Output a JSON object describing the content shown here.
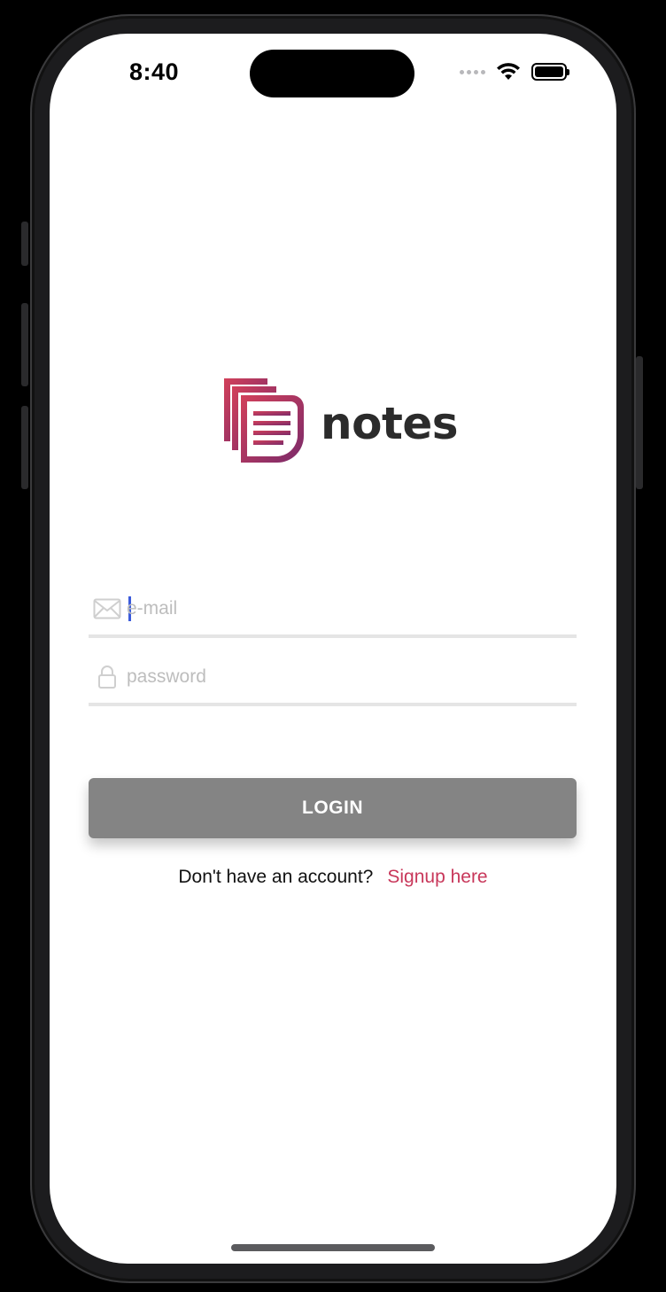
{
  "status_bar": {
    "time": "8:40"
  },
  "app": {
    "name": "notes",
    "brand_gradient_start": "#d2405a",
    "brand_gradient_end": "#7a2a6a"
  },
  "login_form": {
    "email_placeholder": "e-mail",
    "password_placeholder": "password",
    "login_label": "LOGIN",
    "login_color": "#848484"
  },
  "signup": {
    "prompt": "Don't have an account?",
    "link_label": "Signup here",
    "link_color": "#c8375a"
  },
  "icons": [
    "wifi-icon",
    "battery-icon",
    "mail-icon",
    "lock-icon",
    "notes-logo-icon"
  ]
}
